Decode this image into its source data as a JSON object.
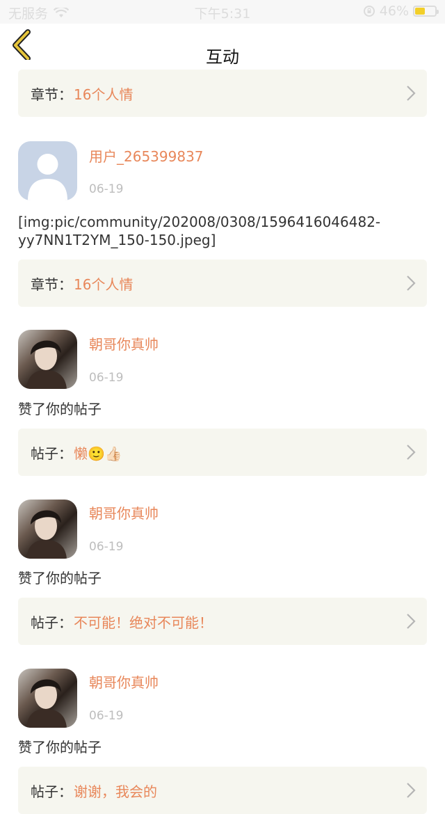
{
  "status_bar": {
    "carrier": "无服务",
    "time": "下午5:31",
    "battery": "46%"
  },
  "nav": {
    "title": "互动",
    "back_icon": "chevron-left-icon"
  },
  "first_card": {
    "label": "章节：",
    "value": "16个人情"
  },
  "items": [
    {
      "username": "用户_265399837",
      "time": "06-19",
      "text": "[img:pic/community/202008/0308/1596416046482-yy7NN1T2YM_150-150.jpeg]",
      "card_label": "章节：",
      "card_value": "16个人情"
    },
    {
      "username": "朝哥你真帅",
      "time": "06-19",
      "text": "赞了你的帖子",
      "card_label": "帖子：",
      "card_value": "懒🙂👍🏻"
    },
    {
      "username": "朝哥你真帅",
      "time": "06-19",
      "text": "赞了你的帖子",
      "card_label": "帖子：",
      "card_value": "不可能！绝对不可能！"
    },
    {
      "username": "朝哥你真帅",
      "time": "06-19",
      "text": "赞了你的帖子",
      "card_label": "帖子：",
      "card_value": "谢谢，我会的"
    }
  ],
  "colors": {
    "accent": "#e8875a",
    "card_bg": "#f6f6ef",
    "time_gray": "#bdbdbd",
    "back_arrow": "#e6c53b"
  }
}
